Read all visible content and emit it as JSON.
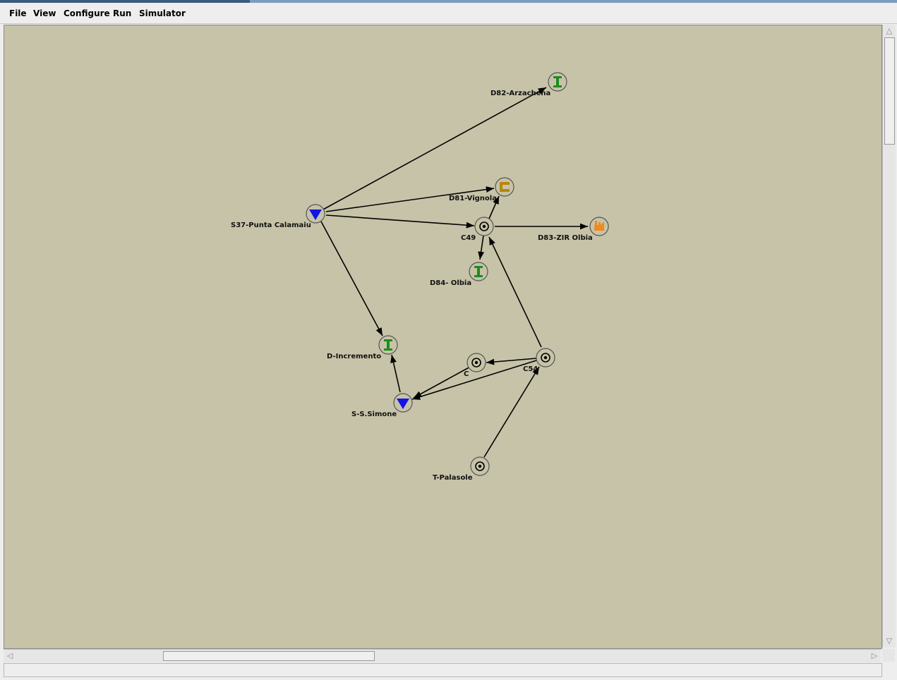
{
  "menu": {
    "file": "File",
    "view": "View",
    "configure": "Configure",
    "run": "Run",
    "simulator": "Simulator"
  },
  "colors": {
    "canvas_bg": "#c7c3a8",
    "source_blue": "#1414e6",
    "demand_green": "#1e8c1e",
    "industry_orange": "#f08a1e",
    "c_gold": "#b8860b"
  },
  "nodes": [
    {
      "id": "d82",
      "label": "D82-Arzachena",
      "icon": "demand-green-icon"
    },
    {
      "id": "d81",
      "label": "D81-Vignola",
      "icon": "gold-c-icon"
    },
    {
      "id": "s37",
      "label": "S37-Punta Calamaiu",
      "icon": "source-triangle-icon"
    },
    {
      "id": "c49",
      "label": "C49",
      "icon": "junction-icon"
    },
    {
      "id": "d83",
      "label": "D83-ZIR Olbia",
      "icon": "industry-icon"
    },
    {
      "id": "d84",
      "label": "D84- Olbia",
      "icon": "demand-green-icon"
    },
    {
      "id": "dinc",
      "label": "D-Incremento",
      "icon": "demand-green-icon"
    },
    {
      "id": "c",
      "label": "C",
      "icon": "junction-icon"
    },
    {
      "id": "c54",
      "label": "C54",
      "icon": "junction-icon"
    },
    {
      "id": "ss",
      "label": "S-S.Simone",
      "icon": "source-triangle-icon"
    },
    {
      "id": "tp",
      "label": "T-Palasole",
      "icon": "junction-icon"
    }
  ]
}
